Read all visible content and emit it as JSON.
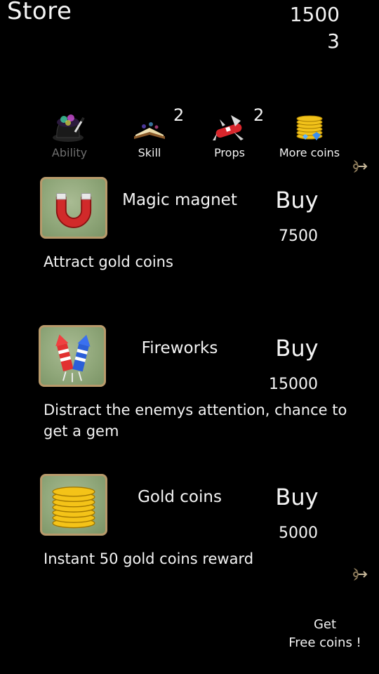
{
  "header": {
    "title": "Store",
    "gold": "1500",
    "gems": "3"
  },
  "tabs": [
    {
      "label": "Ability",
      "icon": "magic-hat-icon",
      "enabled": false,
      "badge": ""
    },
    {
      "label": "Skill",
      "icon": "spellbook-icon",
      "enabled": true,
      "badge": "2"
    },
    {
      "label": "Props",
      "icon": "swiss-knife-icon",
      "enabled": true,
      "badge": "2"
    },
    {
      "label": "More coins",
      "icon": "gold-stack-icon",
      "enabled": true,
      "badge": ""
    }
  ],
  "items": [
    {
      "name": "Magic magnet",
      "buy_label": "Buy",
      "price": "7500",
      "description": "Attract gold coins",
      "icon": "magnet-icon"
    },
    {
      "name": "Fireworks",
      "buy_label": "Buy",
      "price": "15000",
      "description": "Distract the enemys attention, chance to get a gem",
      "icon": "fireworks-icon"
    },
    {
      "name": "Gold coins",
      "buy_label": "Buy",
      "price": "5000",
      "description": "Instant 50 gold coins reward",
      "icon": "coin-stack-icon"
    }
  ],
  "footer": {
    "free_coins_line1": "Get",
    "free_coins_line2": "Free coins !"
  },
  "colors": {
    "background": "#000000",
    "thumb_border": "#b89a6b",
    "thumb_fill": "#90a77a",
    "disabled_text": "#6f6f6f"
  }
}
